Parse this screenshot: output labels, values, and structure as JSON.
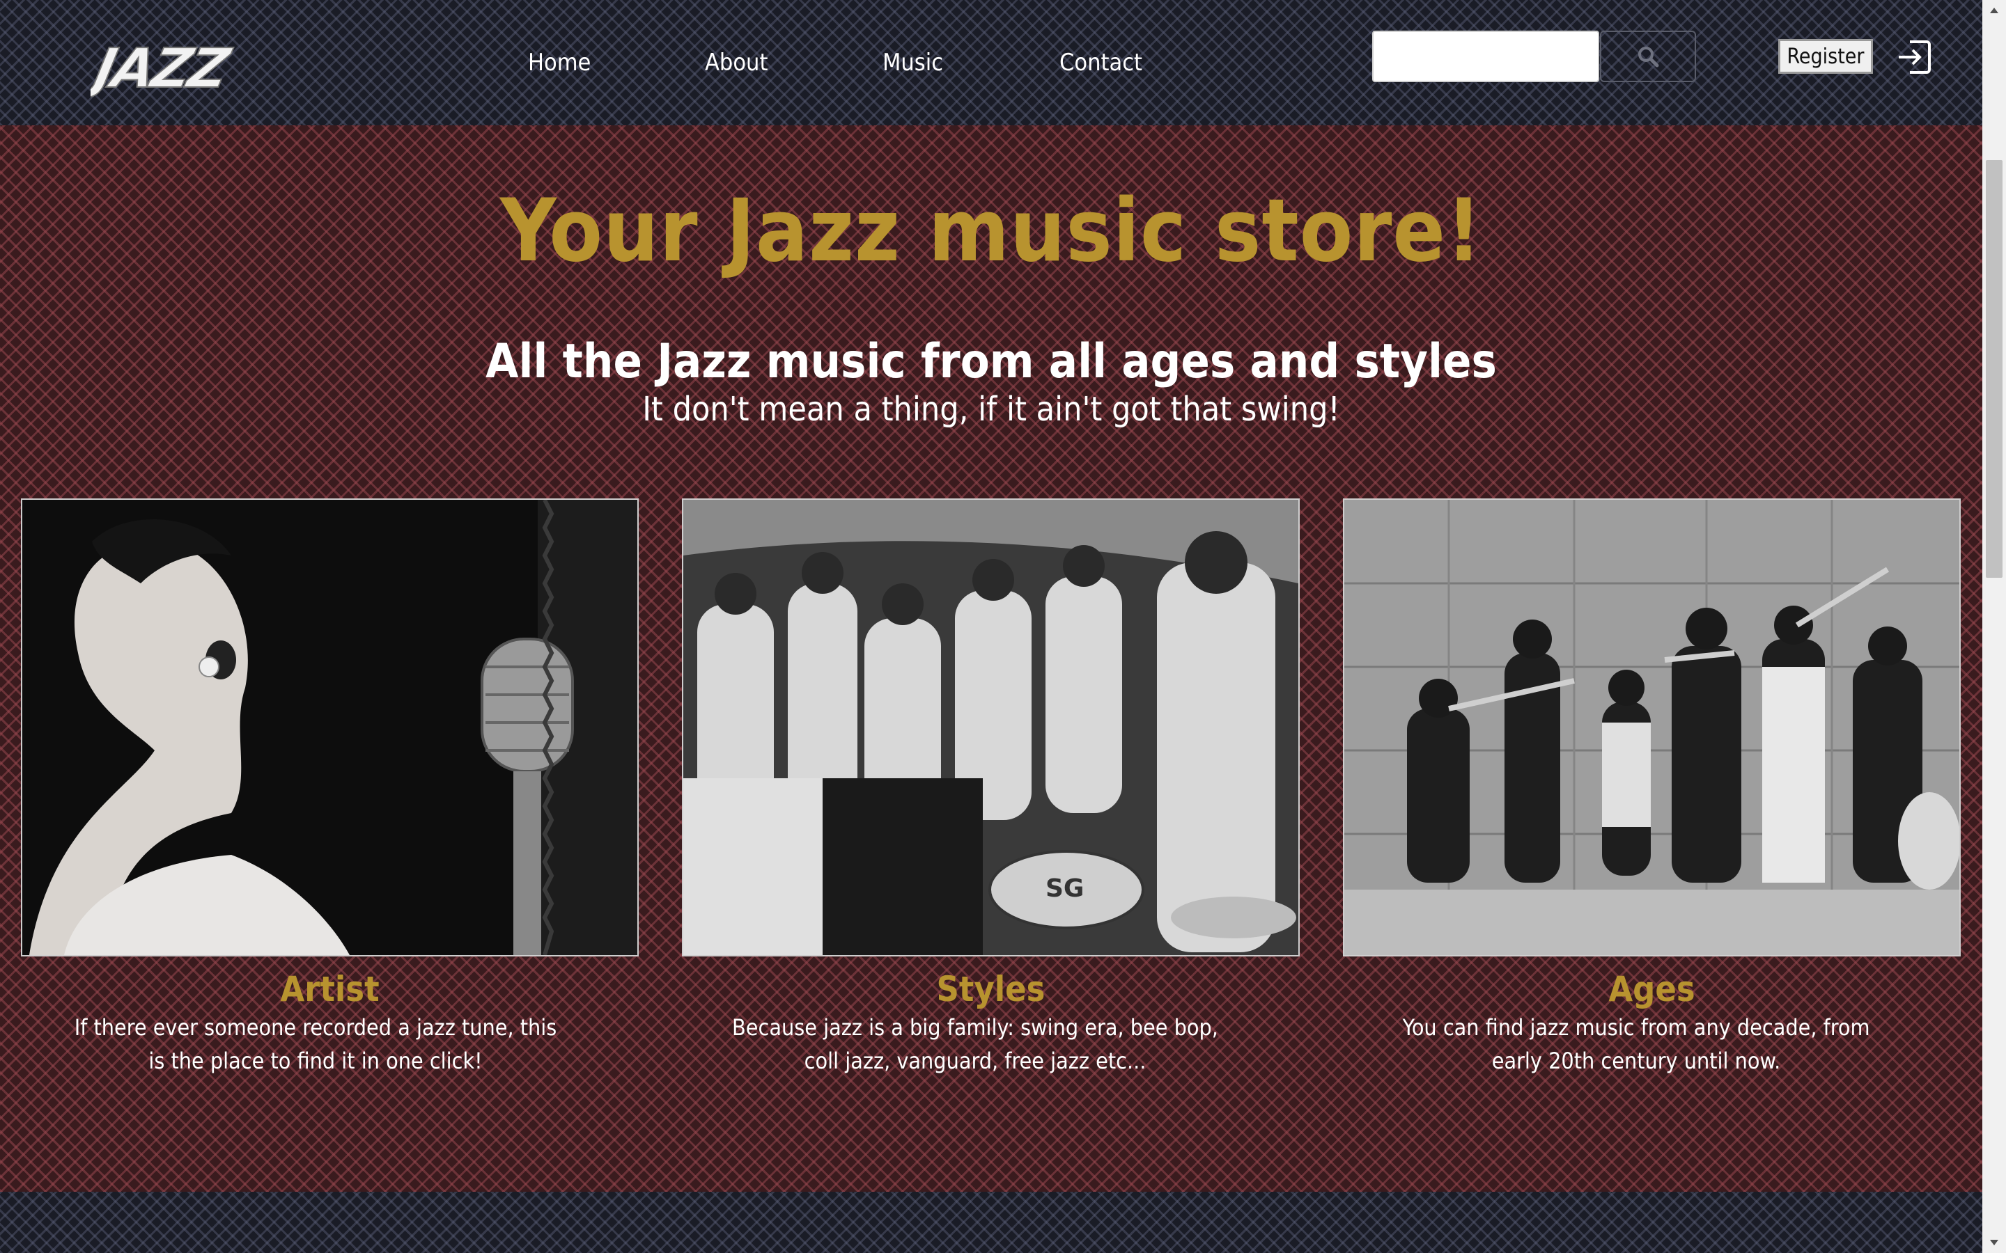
{
  "header": {
    "logo_text": "JAZZ",
    "nav": [
      {
        "label": "Home"
      },
      {
        "label": "About"
      },
      {
        "label": "Music"
      },
      {
        "label": "Contact"
      }
    ],
    "search": {
      "placeholder": "",
      "value": ""
    },
    "register_label": "Register"
  },
  "hero": {
    "title": "Your Jazz music store!",
    "subtitle": "All the Jazz music from all ages and styles",
    "tagline": "It don't mean a thing, if it ain't got that swing!"
  },
  "cards": [
    {
      "title": "Artist",
      "text": "If there ever someone recorded a jazz tune, this is the place to find it in one click!"
    },
    {
      "title": "Styles",
      "text": "Because jazz is a big family: swing era, bee bop, coll jazz, vanguard, free jazz etc..."
    },
    {
      "title": "Ages",
      "text": "You can find jazz music from any decade, from early 20th century until now."
    }
  ],
  "colors": {
    "accent_gold": "#b8932f",
    "header_bg": "#1a1c26",
    "main_bg": "#3a1b1e",
    "text_white": "#ffffff"
  },
  "icons": {
    "search": "search-icon",
    "login": "login-icon",
    "scroll_up": "arrow-up-icon",
    "scroll_down": "arrow-down-icon"
  }
}
